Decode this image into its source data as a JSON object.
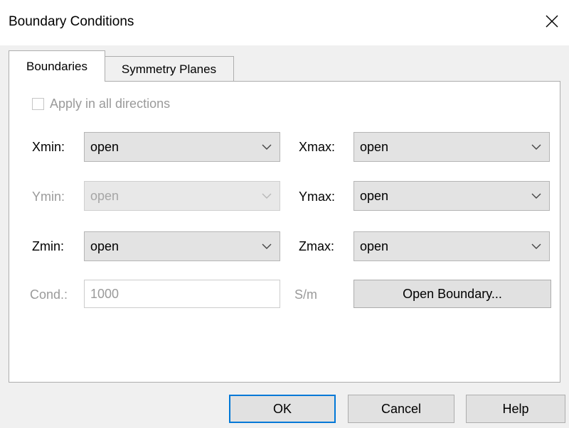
{
  "dialog": {
    "title": "Boundary Conditions",
    "close_icon": "close-icon"
  },
  "tabs": [
    {
      "label": "Boundaries",
      "active": true
    },
    {
      "label": "Symmetry Planes",
      "active": false
    }
  ],
  "apply_all": {
    "label": "Apply in all directions",
    "checked": false,
    "enabled": false
  },
  "boundaries": {
    "xmin": {
      "label": "Xmin:",
      "value": "open",
      "enabled": true
    },
    "xmax": {
      "label": "Xmax:",
      "value": "open",
      "enabled": true
    },
    "ymin": {
      "label": "Ymin:",
      "value": "open",
      "enabled": false
    },
    "ymax": {
      "label": "Ymax:",
      "value": "open",
      "enabled": true
    },
    "zmin": {
      "label": "Zmin:",
      "value": "open",
      "enabled": true
    },
    "zmax": {
      "label": "Zmax:",
      "value": "open",
      "enabled": true
    }
  },
  "conductivity": {
    "label": "Cond.:",
    "value": "1000",
    "unit": "S/m",
    "enabled": false
  },
  "open_boundary_button": "Open Boundary...",
  "footer": {
    "ok": "OK",
    "cancel": "Cancel",
    "help": "Help"
  },
  "colors": {
    "dialog_bg": "#f0f0f0",
    "panel_bg": "#ffffff",
    "focus_border": "#0078d7",
    "disabled_text": "#9a9a9a"
  }
}
